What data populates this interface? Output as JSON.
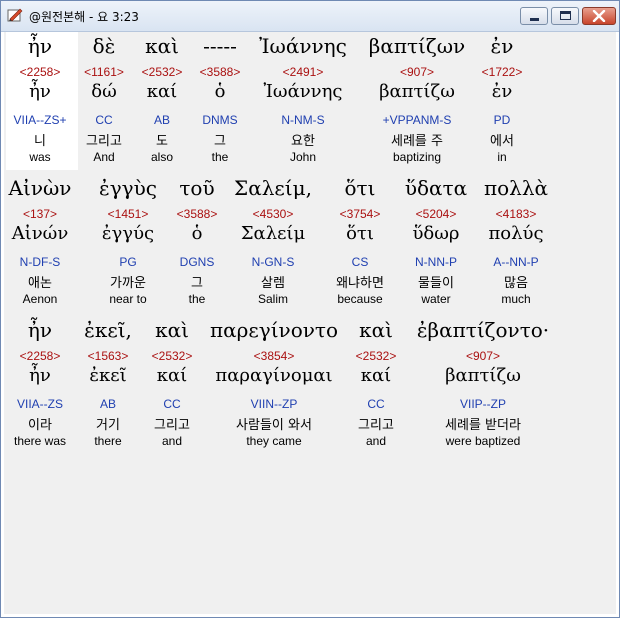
{
  "window": {
    "title": "@원전본해 - 요 3:23"
  },
  "rows": [
    {
      "words": [
        {
          "greek": "ἦν",
          "strong": "<2258>",
          "lemma": "ἦν",
          "morph": "VIIA--ZS+",
          "ko": "니",
          "en": "was"
        },
        {
          "greek": "δὲ",
          "strong": "<1161>",
          "lemma": "δώ",
          "morph": "CC",
          "ko": "그리고",
          "en": "And"
        },
        {
          "greek": "καὶ",
          "strong": "<2532>",
          "lemma": "καί",
          "morph": "AB",
          "ko": "도",
          "en": "also"
        },
        {
          "greek": "-----",
          "strong": "<3588>",
          "lemma": "ὁ",
          "morph": "DNMS",
          "ko": "그",
          "en": "the"
        },
        {
          "greek": "Ἰωάννης",
          "strong": "<2491>",
          "lemma": "Ἰωάννης",
          "morph": "N-NM-S",
          "ko": "요한",
          "en": "John"
        },
        {
          "greek": "βαπτίζων",
          "strong": "<907>",
          "lemma": "βαπτίζω",
          "morph": "+VPPANM-S",
          "ko": "세례를 주",
          "en": "baptizing"
        },
        {
          "greek": "ἐν",
          "strong": "<1722>",
          "lemma": "ἐν",
          "morph": "PD",
          "ko": "에서",
          "en": "in"
        }
      ]
    },
    {
      "words": [
        {
          "greek": "Αἰνὼν",
          "strong": "<137>",
          "lemma": "Αἰνών",
          "morph": "N-DF-S",
          "ko": "애논",
          "en": "Aenon"
        },
        {
          "greek": "ἐγγὺς",
          "strong": "<1451>",
          "lemma": "ἐγγύς",
          "morph": "PG",
          "ko": "가까운",
          "en": "near to"
        },
        {
          "greek": "τοῦ",
          "strong": "<3588>",
          "lemma": "ὁ",
          "morph": "DGNS",
          "ko": "그",
          "en": "the"
        },
        {
          "greek": "Σαλείμ,",
          "strong": "<4530>",
          "lemma": "Σαλείμ",
          "morph": "N-GN-S",
          "ko": "살렘",
          "en": "Salim"
        },
        {
          "greek": "ὅτι",
          "strong": "<3754>",
          "lemma": "ὅτι",
          "morph": "CS",
          "ko": "왜냐하면",
          "en": "because"
        },
        {
          "greek": "ὕδατα",
          "strong": "<5204>",
          "lemma": "ὕδωρ",
          "morph": "N-NN-P",
          "ko": "물들이",
          "en": "water"
        },
        {
          "greek": "πολλὰ",
          "strong": "<4183>",
          "lemma": "πολύς",
          "morph": "A--NN-P",
          "ko": "많음",
          "en": "much"
        }
      ]
    },
    {
      "words": [
        {
          "greek": "ἦν",
          "strong": "<2258>",
          "lemma": "ἦν",
          "morph": "VIIA--ZS",
          "ko": "이라",
          "en": "there was"
        },
        {
          "greek": "ἐκεῖ,",
          "strong": "<1563>",
          "lemma": "ἐκεῖ",
          "morph": "AB",
          "ko": "거기",
          "en": "there"
        },
        {
          "greek": "καὶ",
          "strong": "<2532>",
          "lemma": "καί",
          "morph": "CC",
          "ko": "그리고",
          "en": "and"
        },
        {
          "greek": "παρεγίνοντο",
          "strong": "<3854>",
          "lemma": "παραγίνομαι",
          "morph": "VIIN--ZP",
          "ko": "사람들이 와서",
          "en": "they came"
        },
        {
          "greek": "καὶ",
          "strong": "<2532>",
          "lemma": "καί",
          "morph": "CC",
          "ko": "그리고",
          "en": "and"
        },
        {
          "greek": "ἐβαπτίζοντο·",
          "strong": "<907>",
          "lemma": "βαπτίζω",
          "morph": "VIIP--ZP",
          "ko": "세례를 받더라",
          "en": "were baptized"
        }
      ]
    }
  ]
}
